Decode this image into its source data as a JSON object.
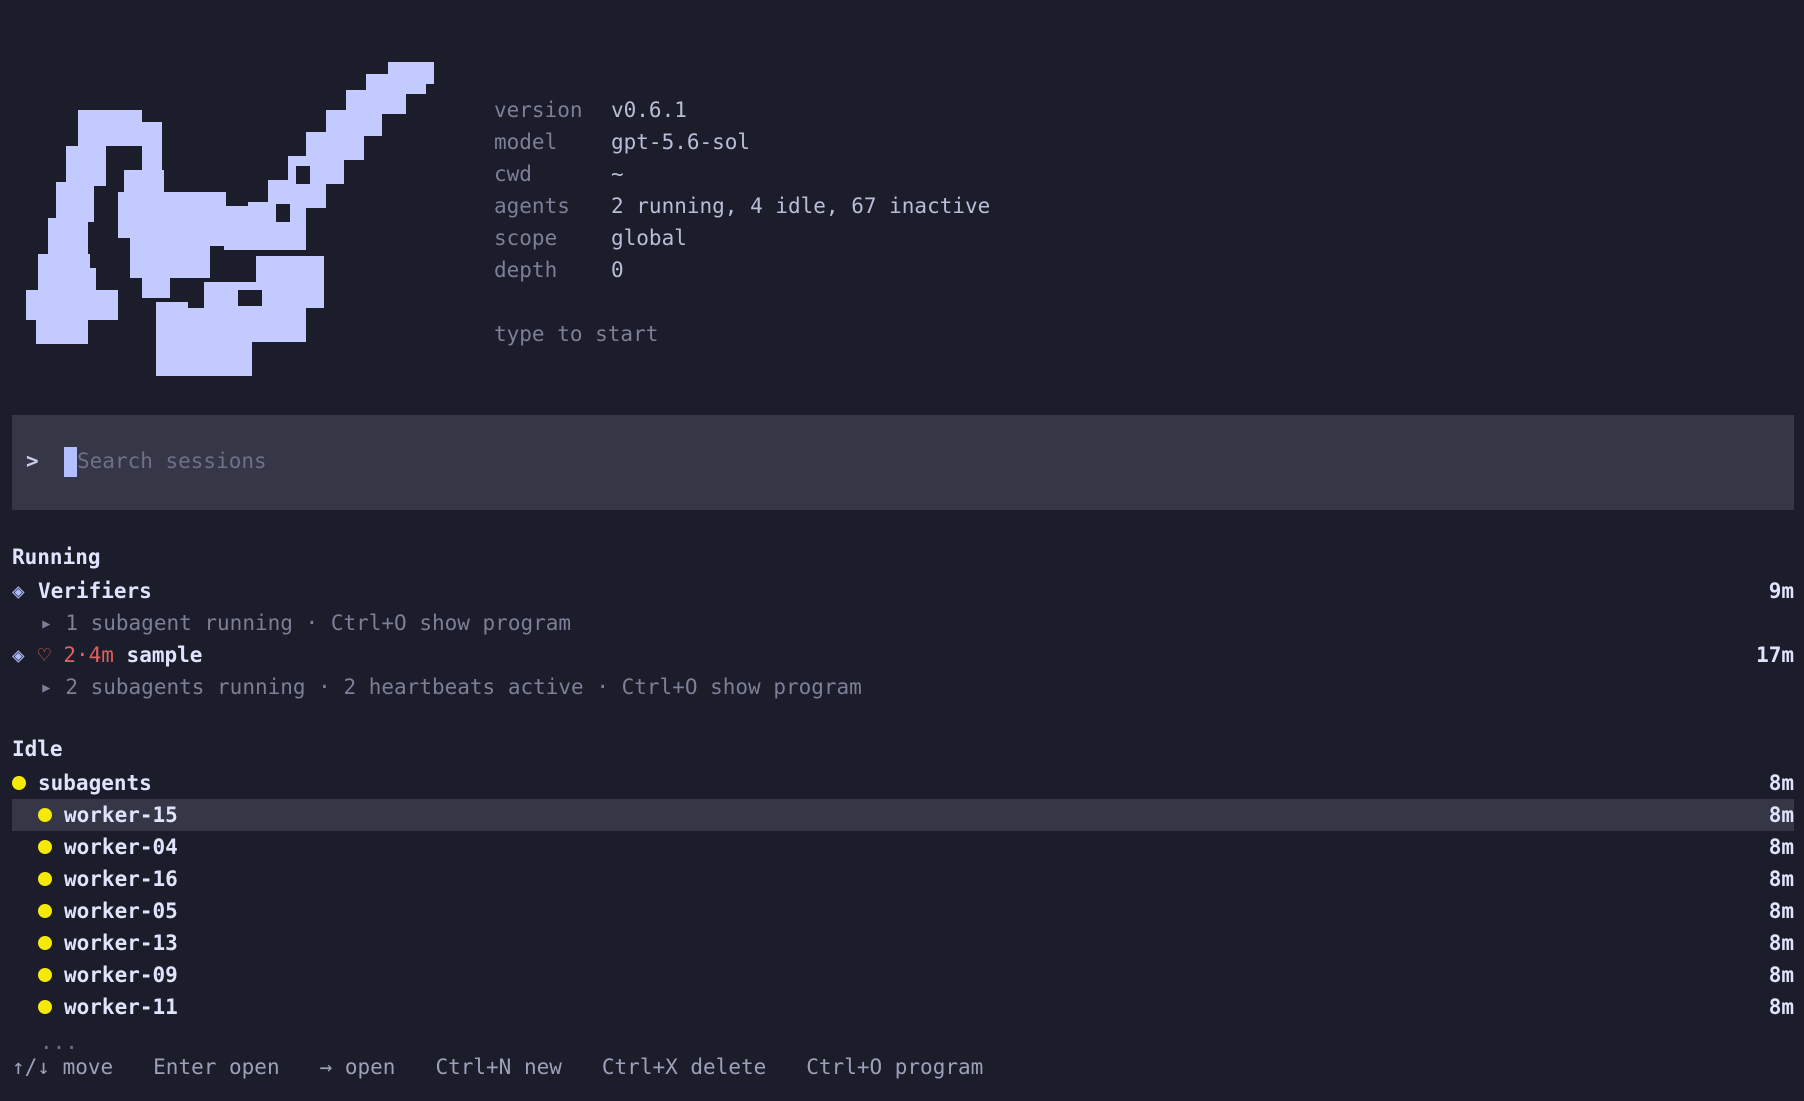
{
  "colors": {
    "background": "#1c1d2b",
    "logo": "#c3caff",
    "search_bg": "#353747",
    "idle_dot": "#f5e90a",
    "heartbeat": "#e0605c"
  },
  "icons": [
    "diamond-icon",
    "heart-icon",
    "triangle-right-icon",
    "status-dot-icon"
  ],
  "info": {
    "version_label": "version",
    "version_value": "v0.6.1",
    "model_label": "model",
    "model_value": "gpt-5.6-sol",
    "cwd_label": "cwd",
    "cwd_value": "~",
    "agents_label": "agents",
    "agents_value": "2 running, 4 idle, 67 inactive",
    "scope_label": "scope",
    "scope_value": "global",
    "depth_label": "depth",
    "depth_value": "0",
    "hint": "type to start"
  },
  "search": {
    "prompt": ">",
    "placeholder": "Search sessions",
    "value": ""
  },
  "running": {
    "title": "Running",
    "sessions": [
      {
        "name": "Verifiers",
        "time": "9m",
        "detail_glyph": "▸",
        "detail": "1 subagent running · Ctrl+O show program"
      },
      {
        "heartbeat": "♡",
        "elapsed": "2·4m",
        "name": "sample",
        "time": "17m",
        "detail_glyph": "▸",
        "detail": "2 subagents running · 2 heartbeats active · Ctrl+O show program"
      }
    ]
  },
  "idle": {
    "title": "Idle",
    "group": {
      "name": "subagents",
      "time": "8m"
    },
    "workers": [
      {
        "name": "worker-15",
        "time": "8m",
        "selected": true
      },
      {
        "name": "worker-04",
        "time": "8m"
      },
      {
        "name": "worker-16",
        "time": "8m"
      },
      {
        "name": "worker-05",
        "time": "8m"
      },
      {
        "name": "worker-13",
        "time": "8m"
      },
      {
        "name": "worker-09",
        "time": "8m"
      },
      {
        "name": "worker-11",
        "time": "8m"
      }
    ],
    "more": "..."
  },
  "footer": {
    "move": "↑/↓ move",
    "enter": "Enter open",
    "arrow": "→ open",
    "new": "Ctrl+N new",
    "delete": "Ctrl+X delete",
    "program": "Ctrl+O program"
  }
}
